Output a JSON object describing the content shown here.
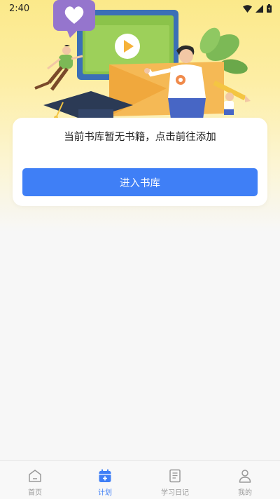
{
  "status_bar": {
    "time": "2:40"
  },
  "card": {
    "message": "当前书库暂无书籍，点击前往添加",
    "button_label": "进入书库"
  },
  "tabs": [
    {
      "label": "首页",
      "icon": "home-icon",
      "active": false
    },
    {
      "label": "计划",
      "icon": "calendar-plus-icon",
      "active": true
    },
    {
      "label": "学习日记",
      "icon": "notebook-icon",
      "active": false
    },
    {
      "label": "我的",
      "icon": "user-icon",
      "active": false
    }
  ],
  "colors": {
    "accent": "#3f7ff6",
    "inactive_tab": "#999999",
    "banner_yellow": "#fbe98a"
  }
}
